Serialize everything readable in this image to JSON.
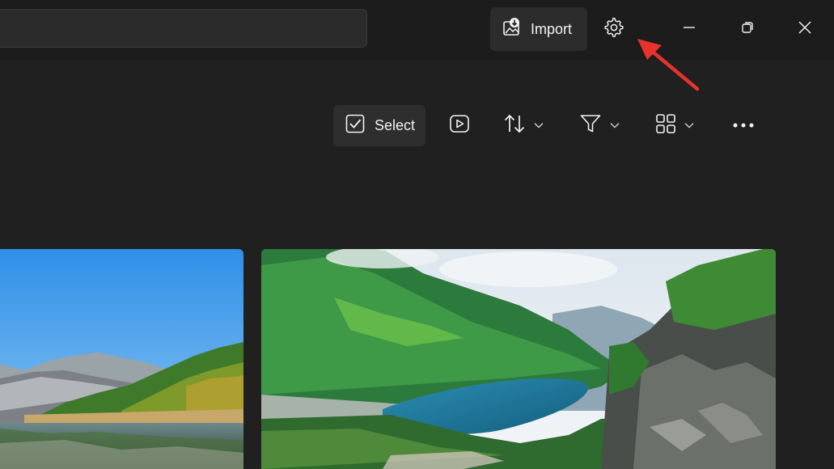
{
  "titlebar": {
    "search": {
      "placeholder": ""
    },
    "import_label": "Import",
    "settings_icon": "gear-icon",
    "window_controls": [
      "minimize-icon",
      "restore-icon",
      "close-icon"
    ]
  },
  "toolbar": {
    "select_label": "Select",
    "icons": [
      "checkbox-icon",
      "slideshow-icon",
      "sort-icon",
      "filter-icon",
      "view-icon",
      "more-icon"
    ]
  },
  "gallery": {
    "photos": [
      {
        "subject": "lake-forest-mountains-landscape"
      },
      {
        "subject": "mountain-valley-lake-landscape"
      }
    ]
  },
  "annotation": {
    "color": "#e8322d"
  },
  "colors": {
    "background": "#202020",
    "titlebar": "#1c1c1c",
    "button": "#2e2e2e"
  }
}
